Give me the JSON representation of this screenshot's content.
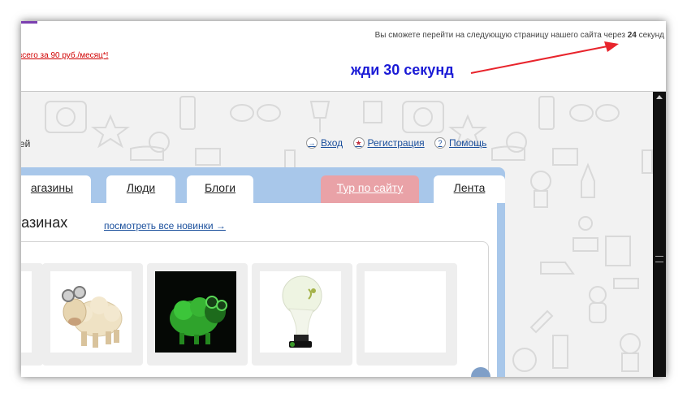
{
  "top_panel": {
    "wait_notice_prefix": "Вы сможете перейти на следующую страницу нашего сайта через",
    "wait_seconds": "24",
    "wait_notice_suffix": "секунд",
    "promo_link": "всего за 90 руб./месяц*!",
    "annotation": "жди 30 секунд",
    "annotation_color": "#1b1bd6",
    "arrow_color": "#e8242c"
  },
  "header": {
    "user_text": "ей",
    "links": [
      {
        "label": "Вход",
        "icon": "login-arrow-icon"
      },
      {
        "label": "Регистрация",
        "icon": "star-icon"
      },
      {
        "label": "Помощь",
        "icon": "question-icon"
      }
    ]
  },
  "tabs": {
    "shops": "агазины",
    "people": "Люди",
    "blogs": "Блоги",
    "tour": "Тур по сайту",
    "feed": "Лента"
  },
  "section": {
    "title": "газинах",
    "link": "посмотреть все новинки →"
  },
  "products": [
    {
      "name": "product-partial"
    },
    {
      "name": "sheep-with-goggles"
    },
    {
      "name": "glowing-green-sheep"
    },
    {
      "name": "white-figurine"
    },
    {
      "name": "empty"
    }
  ]
}
